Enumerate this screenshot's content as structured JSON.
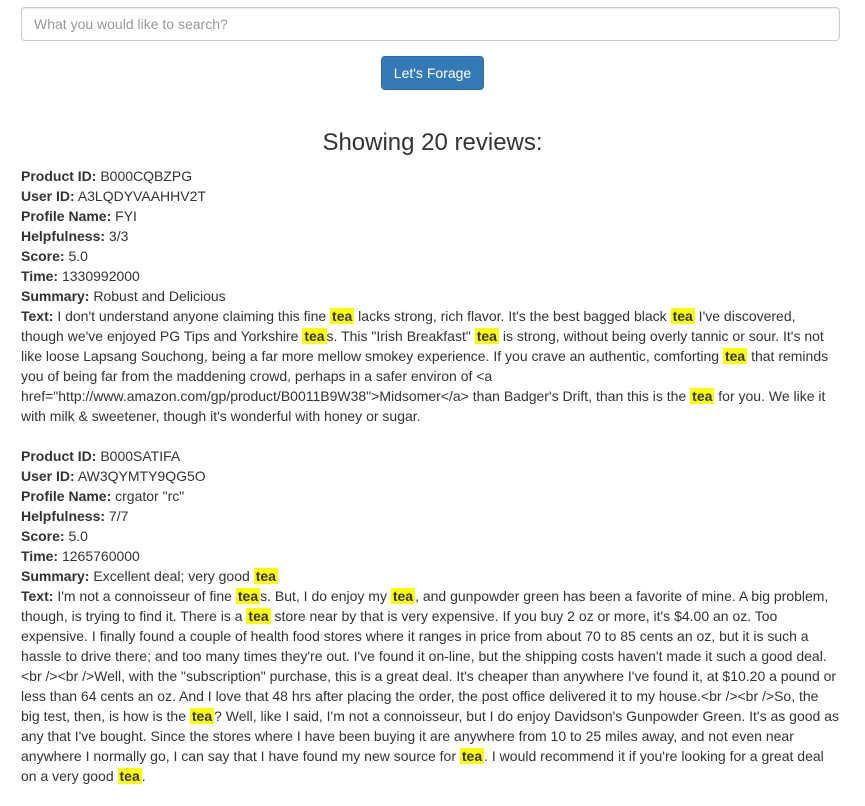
{
  "search": {
    "placeholder": "What you would like to search?"
  },
  "button": {
    "label": "Let's Forage"
  },
  "heading": "Showing 20 reviews:",
  "labels": {
    "product_id": "Product ID:",
    "user_id": "User ID:",
    "profile_name": "Profile Name:",
    "helpfulness": "Helpfulness:",
    "score": "Score:",
    "time": "Time:",
    "summary": "Summary:",
    "text": "Text:"
  },
  "highlight_term": "tea",
  "highlight_color": "#ffff00",
  "accent_color": "#337ab7",
  "reviews": [
    {
      "product_id": "B000CQBZPG",
      "user_id": "A3LQDYVAAHHV2T",
      "profile_name": "FYI",
      "helpfulness": "3/3",
      "score": "5.0",
      "time": "1330992000",
      "summary": "Robust and Delicious",
      "text": "I don't understand anyone claiming this fine tea lacks strong, rich flavor. It's the best bagged black tea I've discovered, though we've enjoyed PG Tips and Yorkshire teas. This \"Irish Breakfast\" tea is strong, without being overly tannic or sour. It's not like loose Lapsang Souchong, being a far more mellow smokey experience. If you crave an authentic, comforting tea that reminds you of being far from the maddening crowd, perhaps in a safer environ of <a href=\"http://www.amazon.com/gp/product/B0011B9W38\">Midsomer</a> than Badger's Drift, than this is the tea for you. We like it with milk & sweetener, though it's wonderful with honey or sugar."
    },
    {
      "product_id": "B000SATIFA",
      "user_id": "AW3QYMTY9QG5O",
      "profile_name": "crgator \"rc\"",
      "helpfulness": "7/7",
      "score": "5.0",
      "time": "1265760000",
      "summary": "Excellent deal; very good tea",
      "text": "I'm not a connoisseur of fine teas. But, I do enjoy my tea, and gunpowder green has been a favorite of mine. A big problem, though, is trying to find it. There is a tea store near by that is very expensive. If you buy 2 oz or more, it's $4.00 an oz. Too expensive. I finally found a couple of health food stores where it ranges in price from about 70 to 85 cents an oz, but it is such a hassle to drive there; and too many times they're out. I've found it on-line, but the shipping costs haven't made it such a good deal.<br /><br />Well, with the \"subscription\" purchase, this is a great deal. It's cheaper than anywhere I've found it, at $10.20 a pound or less than 64 cents an oz. And I love that 48 hrs after placing the order, the post office delivered it to my house.<br /><br />So, the big test, then, is how is the tea? Well, like I said, I'm not a connoisseur, but I do enjoy Davidson's Gunpowder Green. It's as good as any that I've bought. Since the stores where I have been buying it are anywhere from 10 to 25 miles away, and not even near anywhere I normally go, I can say that I have found my new source for tea. I would recommend it if you're looking for a great deal on a very good tea."
    }
  ]
}
